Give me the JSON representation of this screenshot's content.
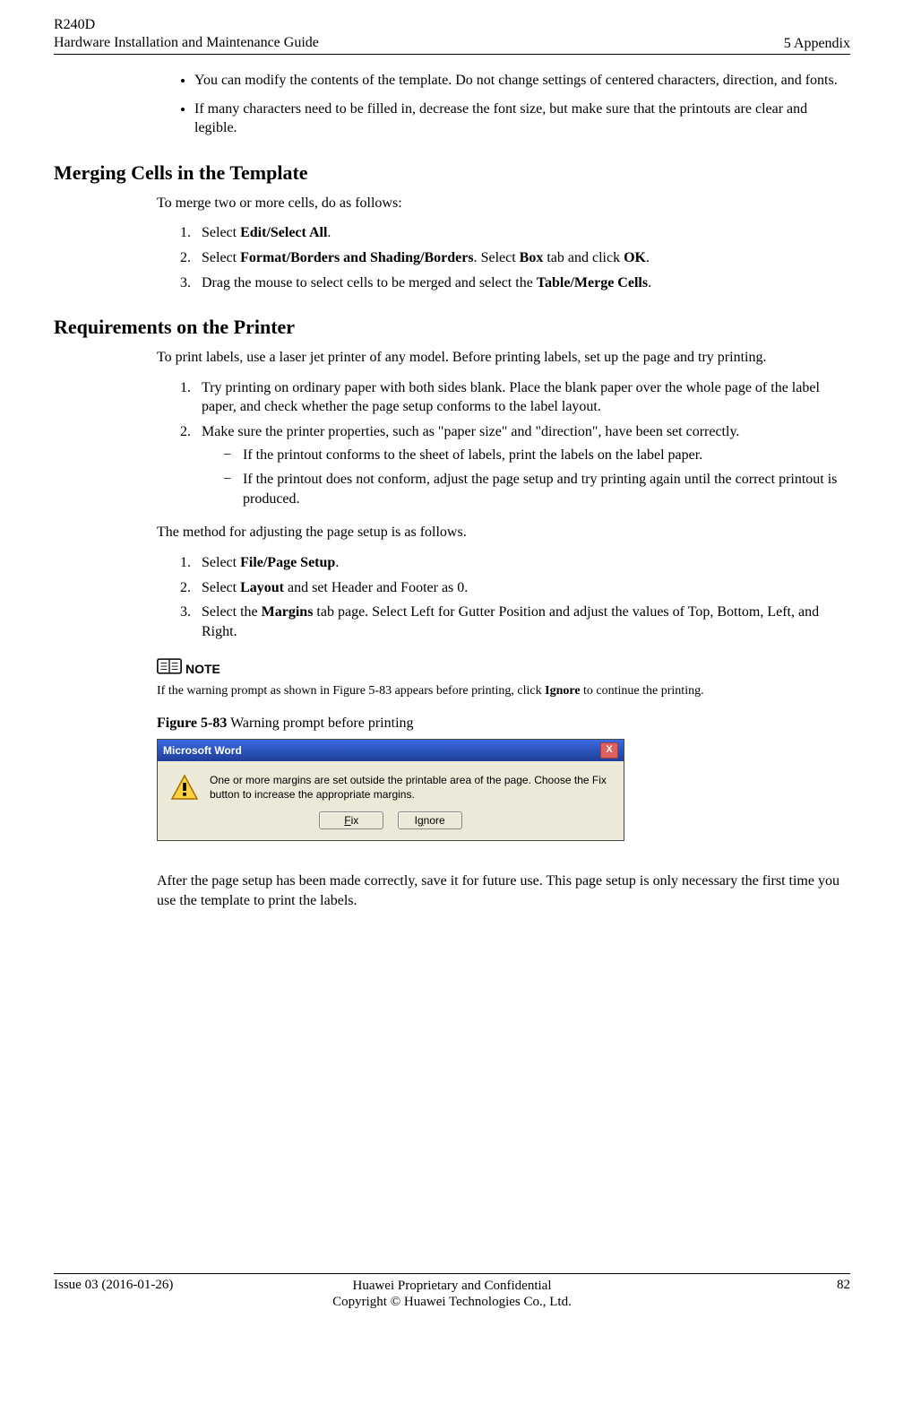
{
  "header": {
    "left_line1": "R240D",
    "left_line2": "Hardware Installation and Maintenance Guide",
    "right": "5 Appendix"
  },
  "bullets_top": [
    "You can modify the contents of the template. Do not change settings of centered characters, direction, and fonts.",
    "If many characters need to be filled in, decrease the font size, but make sure that the printouts are clear and legible."
  ],
  "section_merge": {
    "title": "Merging Cells in the Template",
    "lead": "To merge two or more cells, do as follows:",
    "steps": [
      {
        "pre": "Select ",
        "bold": "Edit/Select All",
        "post": "."
      },
      {
        "pre": "Select ",
        "bold": "Format/Borders and Shading/Borders",
        "post": ". Select ",
        "bold2": "Box",
        "post2": " tab and click ",
        "bold3": "OK",
        "post3": "."
      },
      {
        "pre": "Drag the mouse to select cells to be merged and select the ",
        "bold": "Table/Merge Cells",
        "post": "."
      }
    ]
  },
  "section_printer": {
    "title": "Requirements on the Printer",
    "lead": "To print labels, use a laser jet printer of any model. Before printing labels, set up the page and try printing.",
    "steps1": [
      "Try printing on ordinary paper with both sides blank. Place the blank paper over the whole page of the label paper, and check whether the page setup conforms to the label layout.",
      "Make sure the printer properties, such as \"paper size\" and \"direction\", have been set correctly."
    ],
    "substeps": [
      "If the printout conforms to the sheet of labels, print the labels on the label paper.",
      "If the printout does not conform, adjust the page setup and try printing again until the correct printout is produced."
    ],
    "after_sub": "The method for adjusting the page setup is as follows.",
    "steps2": [
      {
        "pre": "Select ",
        "bold": "File/Page Setup",
        "post": "."
      },
      {
        "pre": "Select ",
        "bold": "Layout",
        "post": " and set Header and Footer as 0."
      },
      {
        "pre": "Select the ",
        "bold": "Margins",
        "post": " tab page. Select Left for Gutter Position and adjust the values of Top, Bottom, Left, and Right."
      }
    ]
  },
  "note": {
    "label": "NOTE",
    "body_pre": "If the warning prompt as shown in ",
    "body_ref": "Figure 5-83",
    "body_mid": " appears before printing, click ",
    "body_bold": "Ignore",
    "body_post": " to continue the printing."
  },
  "figure": {
    "caption_bold": "Figure 5-83",
    "caption_rest": " Warning prompt before printing"
  },
  "dialog": {
    "title": "Microsoft Word",
    "message": "One or more margins are set outside the printable area of the page.  Choose the Fix button to increase the appropriate margins.",
    "btn_fix_u": "F",
    "btn_fix_rest": "ix",
    "btn_ignore_pre": "I",
    "btn_ignore_u": "g",
    "btn_ignore_rest": "nore",
    "close_x": "X"
  },
  "after_dialog": "After the page setup has been made correctly, save it for future use. This page setup is only necessary the first time you use the template to print the labels.",
  "footer": {
    "left": "Issue 03 (2016-01-26)",
    "center_line1": "Huawei Proprietary and Confidential",
    "center_line2": "Copyright © Huawei Technologies Co., Ltd.",
    "right": "82"
  }
}
